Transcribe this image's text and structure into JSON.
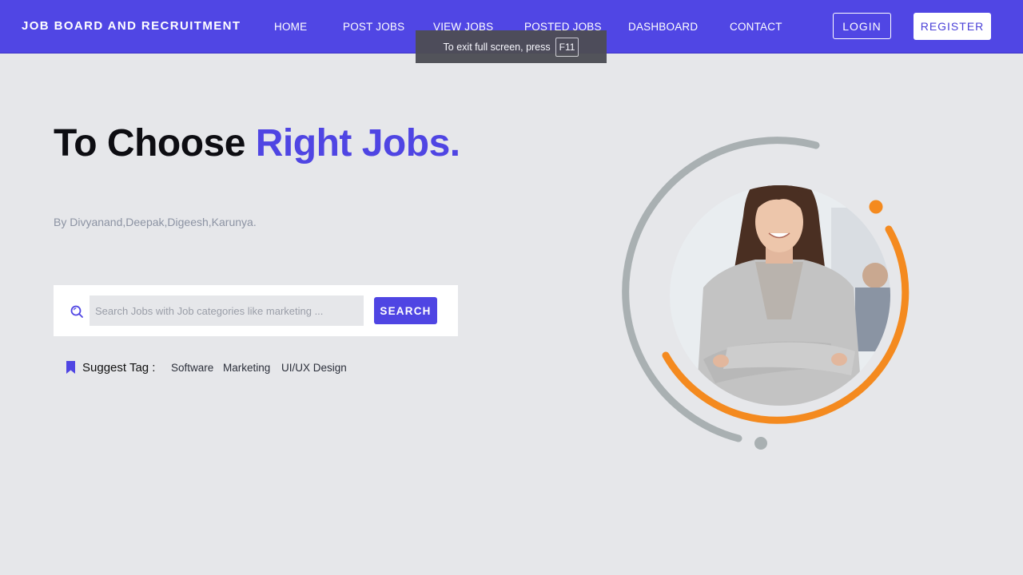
{
  "brand": "JOB BOARD AND RECRUITMENT",
  "nav": [
    "HOME",
    "POST JOBS",
    "VIEW JOBS",
    "POSTED JOBS",
    "DASHBOARD",
    "CONTACT"
  ],
  "auth": {
    "login": "LOGIN",
    "register": "REGISTER"
  },
  "toast": {
    "text": "To exit full screen, press",
    "key": "F11"
  },
  "hero": {
    "title_part1": "To Choose ",
    "title_accent": "Right Jobs.",
    "subtitle": "By Divyanand,Deepak,Digeesh,Karunya."
  },
  "search": {
    "placeholder": "Search Jobs with Job categories like marketing ...",
    "button": "SEARCH"
  },
  "suggest": {
    "label": "Suggest Tag :",
    "tags": [
      "Software",
      "Marketing",
      "UI/UX Design"
    ]
  },
  "colors": {
    "primary": "#5046e4",
    "background": "#e6e7ea",
    "ring_gray": "#a9b0b2",
    "ring_orange": "#f48a1f"
  }
}
